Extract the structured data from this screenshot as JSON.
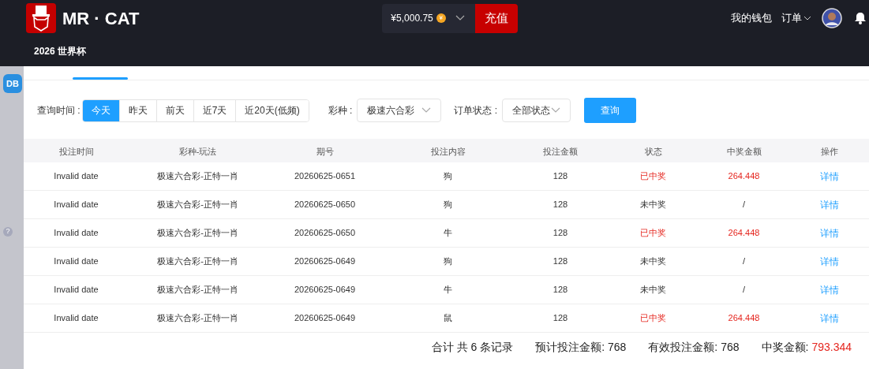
{
  "header": {
    "brand": "MR · CAT",
    "balance": "¥5,000.75",
    "currency_badge": "¥",
    "recharge": "充值",
    "wallet": "我的钱包",
    "orders": "订单",
    "subnav": "2026 世界杯"
  },
  "background": {
    "logo": "DB",
    "help": "?"
  },
  "filters": {
    "time_label": "查询时间 :",
    "time_options": [
      {
        "label": "今天",
        "selected": true
      },
      {
        "label": "昨天",
        "selected": false
      },
      {
        "label": "前天",
        "selected": false
      },
      {
        "label": "近7天",
        "selected": false
      },
      {
        "label": "近20天(低频)",
        "selected": false
      }
    ],
    "lottery_label": "彩种 :",
    "lottery_value": "极速六合彩",
    "status_label": "订单状态 :",
    "status_value": "全部状态",
    "query": "查询"
  },
  "table": {
    "columns": [
      "投注时间",
      "彩种-玩法",
      "期号",
      "投注内容",
      "投注金额",
      "状态",
      "中奖金额",
      "操作"
    ],
    "rows": [
      {
        "time": "Invalid date",
        "game": "极速六合彩-正特一肖",
        "issue": "20260625-0651",
        "content": "狗",
        "amount": "128",
        "status": "已中奖",
        "won": true,
        "prize": "264.448",
        "action": "详情"
      },
      {
        "time": "Invalid date",
        "game": "极速六合彩-正特一肖",
        "issue": "20260625-0650",
        "content": "狗",
        "amount": "128",
        "status": "未中奖",
        "won": false,
        "prize": "/",
        "action": "详情"
      },
      {
        "time": "Invalid date",
        "game": "极速六合彩-正特一肖",
        "issue": "20260625-0650",
        "content": "牛",
        "amount": "128",
        "status": "已中奖",
        "won": true,
        "prize": "264.448",
        "action": "详情"
      },
      {
        "time": "Invalid date",
        "game": "极速六合彩-正特一肖",
        "issue": "20260625-0649",
        "content": "狗",
        "amount": "128",
        "status": "未中奖",
        "won": false,
        "prize": "/",
        "action": "详情"
      },
      {
        "time": "Invalid date",
        "game": "极速六合彩-正特一肖",
        "issue": "20260625-0649",
        "content": "牛",
        "amount": "128",
        "status": "未中奖",
        "won": false,
        "prize": "/",
        "action": "详情"
      },
      {
        "time": "Invalid date",
        "game": "极速六合彩-正特一肖",
        "issue": "20260625-0649",
        "content": "鼠",
        "amount": "128",
        "status": "已中奖",
        "won": true,
        "prize": "264.448",
        "action": "详情"
      }
    ]
  },
  "summary": {
    "count": "合计 共 6 条记录",
    "expected": "预计投注金额: 768",
    "valid": "有效投注金额: 768",
    "prize_label": "中奖金额:",
    "prize_value": "793.344"
  }
}
